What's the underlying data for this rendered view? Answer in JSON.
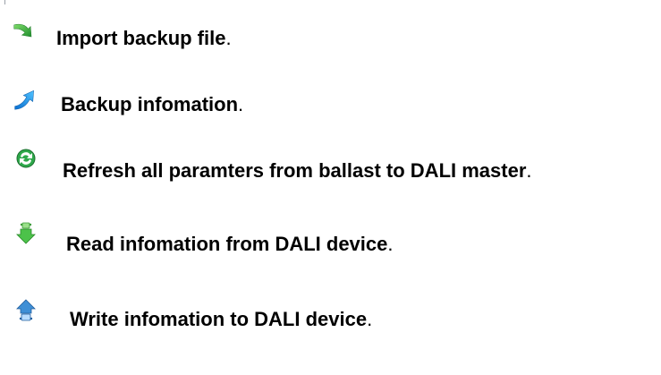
{
  "items": [
    {
      "icon": "import-arrow-icon",
      "label": "Import backup file",
      "period": "."
    },
    {
      "icon": "backup-arrow-icon",
      "label": "Backup infomation",
      "period": "."
    },
    {
      "icon": "refresh-icon",
      "label": "Refresh all paramters from ballast to DALI master",
      "period": "."
    },
    {
      "icon": "read-device-icon",
      "label": "Read infomation from DALI device",
      "period": "."
    },
    {
      "icon": "write-device-icon",
      "label": "Write infomation to DALI device",
      "period": "."
    }
  ],
  "colors": {
    "import_green": "#3cb043",
    "backup_blue": "#1a8fe3",
    "refresh_green": "#2ea84a",
    "read_green": "#4cc24a",
    "write_blue": "#3f8fd6"
  }
}
